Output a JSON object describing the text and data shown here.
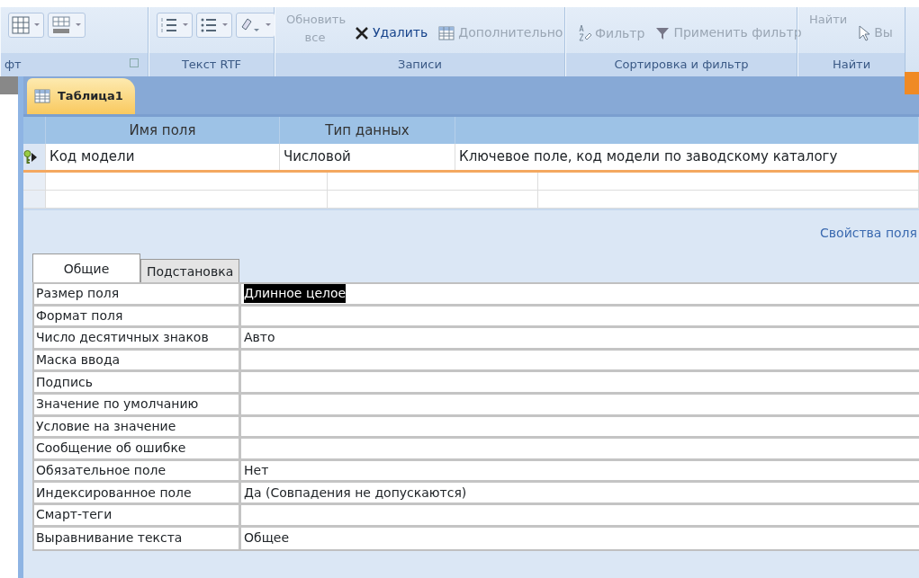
{
  "ribbon": {
    "groups": [
      {
        "label": "фт",
        "kind": "icons"
      },
      {
        "label": "Текст RTF",
        "kind": "icons"
      },
      {
        "label": "Записи",
        "kind": "buttons",
        "buttons": [
          {
            "label": "Обновить все",
            "disabled": true
          },
          {
            "label": "Удалить",
            "disabled": false
          },
          {
            "label": "Дополнительно",
            "disabled": true
          }
        ]
      },
      {
        "label": "Сортировка и фильтр",
        "kind": "buttons",
        "buttons": [
          {
            "label": "Фильтр",
            "disabled": true
          },
          {
            "label": "Применить фильтр",
            "disabled": true
          }
        ]
      },
      {
        "label": "Найти",
        "kind": "buttons",
        "buttons": [
          {
            "label": "Найти",
            "disabled": true
          },
          {
            "label": "Вы",
            "disabled": true
          }
        ]
      }
    ]
  },
  "document_tab": {
    "title": "Таблица1",
    "selected": true
  },
  "fields_table": {
    "columns": [
      "Имя поля",
      "Тип данных"
    ],
    "rows": [
      {
        "name": "Код модели",
        "type": "Числовой",
        "description": "Ключевое поле, код модели по заводскому каталогу",
        "primary_key": true,
        "current": true
      }
    ]
  },
  "properties": {
    "title": "Свойства поля",
    "tabs": [
      {
        "label": "Общие",
        "selected": true
      },
      {
        "label": "Подстановка",
        "selected": false
      }
    ],
    "rows": [
      {
        "label": "Размер поля",
        "value": "Длинное целое",
        "highlighted": true
      },
      {
        "label": "Формат поля",
        "highlighted": false
      },
      {
        "label": "Число десятичных знаков",
        "value": "Авто",
        "highlighted": false
      },
      {
        "label": "Маска ввода",
        "highlighted": false
      },
      {
        "label": "Подпись",
        "highlighted": false
      },
      {
        "label": "Значение по умолчанию",
        "highlighted": false
      },
      {
        "label": "Условие на значение",
        "highlighted": false
      },
      {
        "label": "Сообщение об ошибке",
        "highlighted": false
      },
      {
        "label": "Обязательное поле",
        "value": "Нет",
        "highlighted": false
      },
      {
        "label": "Индексированное поле",
        "value": "Да (Совпадения не допускаются)",
        "highlighted": false
      },
      {
        "label": "Смарт-теги",
        "highlighted": false
      },
      {
        "label": "Выравнивание текста",
        "value": "Общее",
        "highlighted": false
      }
    ]
  }
}
